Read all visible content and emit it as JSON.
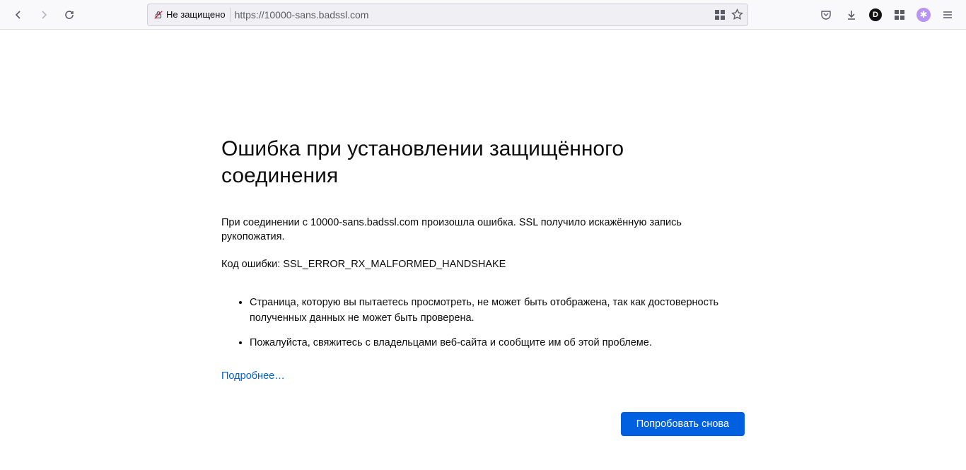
{
  "toolbar": {
    "security_label": "Не защищено",
    "url": "https://10000-sans.badssl.com"
  },
  "error": {
    "title": "Ошибка при установлении защищённого соединения",
    "message": "При соединении с 10000-sans.badssl.com произошла ошибка. SSL получило искажённую запись рукопожатия.",
    "code_label": "Код ошибки:",
    "code": "SSL_ERROR_RX_MALFORMED_HANDSHAKE",
    "bullets": [
      "Страница, которую вы пытаетесь просмотреть, не может быть отображена, так как достоверность полученных данных не может быть проверена.",
      "Пожалуйста, свяжитесь с владельцами веб-сайта и сообщите им об этой проблеме."
    ],
    "more_link": "Подробнее…",
    "retry_button": "Попробовать снова"
  }
}
